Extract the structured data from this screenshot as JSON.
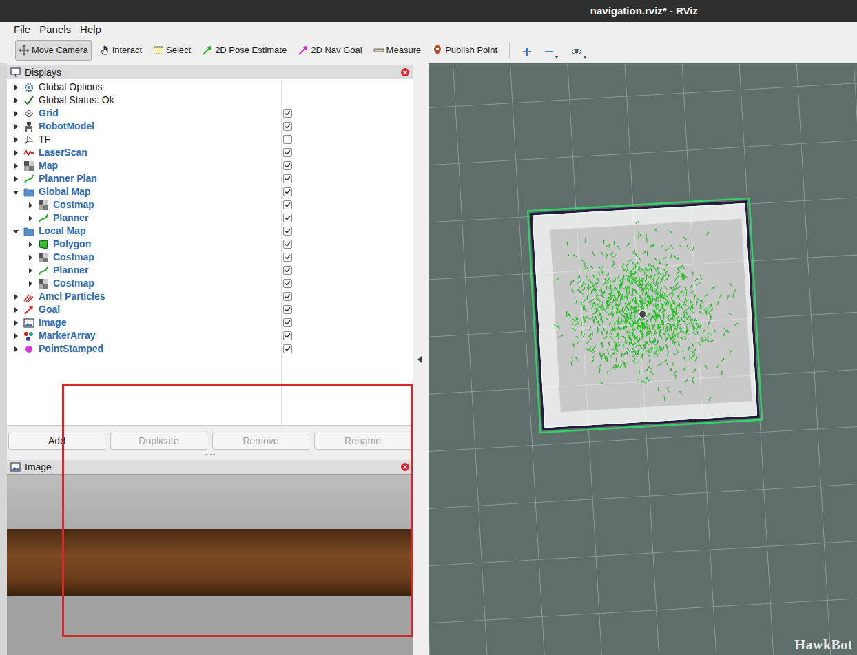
{
  "window": {
    "title": "navigation.rviz* - RViz"
  },
  "menu": [
    "File",
    "Panels",
    "Help"
  ],
  "toolbar": {
    "tools": [
      {
        "label": "Move Camera",
        "kind": "camera",
        "selected": true
      },
      {
        "label": "Interact",
        "kind": "interact",
        "selected": false
      },
      {
        "label": "Select",
        "kind": "select",
        "selected": false
      },
      {
        "label": "2D Pose Estimate",
        "kind": "pose",
        "selected": false
      },
      {
        "label": "2D Nav Goal",
        "kind": "goal",
        "selected": false
      },
      {
        "label": "Measure",
        "kind": "measure",
        "selected": false
      },
      {
        "label": "Publish Point",
        "kind": "publish",
        "selected": false
      }
    ],
    "view_controls": [
      {
        "kind": "zoom-in",
        "has_dropdown": false
      },
      {
        "kind": "zoom-out",
        "has_dropdown": true
      },
      {
        "kind": "eye",
        "has_dropdown": true
      }
    ]
  },
  "displays_panel": {
    "title": "Displays",
    "items": [
      {
        "label": "Global Options",
        "kind": "options",
        "level": 0,
        "expanded": false,
        "has_checkbox": false,
        "checked": false
      },
      {
        "label": "Global Status: Ok",
        "kind": "status",
        "level": 0,
        "expanded": false,
        "has_checkbox": false,
        "checked": false
      },
      {
        "label": "Grid",
        "kind": "grid",
        "level": 0,
        "expanded": false,
        "has_checkbox": true,
        "checked": true
      },
      {
        "label": "RobotModel",
        "kind": "robot",
        "level": 0,
        "expanded": false,
        "has_checkbox": true,
        "checked": true
      },
      {
        "label": "TF",
        "kind": "tf",
        "level": 0,
        "expanded": false,
        "has_checkbox": true,
        "checked": false
      },
      {
        "label": "LaserScan",
        "kind": "laser",
        "level": 0,
        "expanded": false,
        "has_checkbox": true,
        "checked": true
      },
      {
        "label": "Map",
        "kind": "map",
        "level": 0,
        "expanded": false,
        "has_checkbox": true,
        "checked": true
      },
      {
        "label": "Planner Plan",
        "kind": "path",
        "level": 0,
        "expanded": false,
        "has_checkbox": true,
        "checked": true
      },
      {
        "label": "Global Map",
        "kind": "group",
        "level": 0,
        "expanded": true,
        "has_checkbox": true,
        "checked": true
      },
      {
        "label": "Costmap",
        "kind": "map",
        "level": 1,
        "expanded": false,
        "has_checkbox": true,
        "checked": true
      },
      {
        "label": "Planner",
        "kind": "path",
        "level": 1,
        "expanded": false,
        "has_checkbox": true,
        "checked": true
      },
      {
        "label": "Local Map",
        "kind": "group",
        "level": 0,
        "expanded": true,
        "has_checkbox": true,
        "checked": true
      },
      {
        "label": "Polygon",
        "kind": "polygon",
        "level": 1,
        "expanded": false,
        "has_checkbox": true,
        "checked": true
      },
      {
        "label": "Costmap",
        "kind": "map",
        "level": 1,
        "expanded": false,
        "has_checkbox": true,
        "checked": true
      },
      {
        "label": "Planner",
        "kind": "path",
        "level": 1,
        "expanded": false,
        "has_checkbox": true,
        "checked": true
      },
      {
        "label": "Costmap",
        "kind": "map",
        "level": 1,
        "expanded": false,
        "has_checkbox": true,
        "checked": true
      },
      {
        "label": "Amcl Particles",
        "kind": "posearray",
        "level": 0,
        "expanded": false,
        "has_checkbox": true,
        "checked": true
      },
      {
        "label": "Goal",
        "kind": "pose",
        "level": 0,
        "expanded": false,
        "has_checkbox": true,
        "checked": true
      },
      {
        "label": "Image",
        "kind": "image",
        "level": 0,
        "expanded": false,
        "has_checkbox": true,
        "checked": true
      },
      {
        "label": "MarkerArray",
        "kind": "marker",
        "level": 0,
        "expanded": false,
        "has_checkbox": true,
        "checked": true
      },
      {
        "label": "PointStamped",
        "kind": "point",
        "level": 0,
        "expanded": false,
        "has_checkbox": true,
        "checked": true
      }
    ],
    "buttons": [
      {
        "label": "Add",
        "disabled": false
      },
      {
        "label": "Duplicate",
        "disabled": true
      },
      {
        "label": "Remove",
        "disabled": true
      },
      {
        "label": "Rename",
        "disabled": true
      }
    ]
  },
  "image_panel": {
    "title": "Image"
  },
  "watermark": "HawkBot"
}
